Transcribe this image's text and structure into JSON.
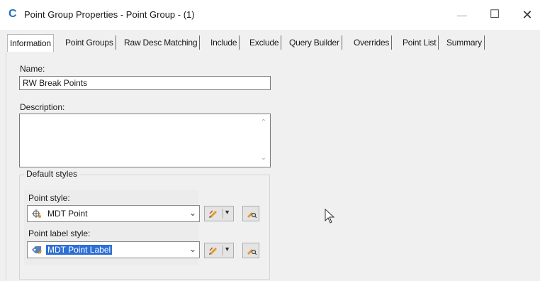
{
  "window": {
    "title": "Point Group Properties - Point Group - (1)",
    "app_icon_glyph": "C",
    "minimize": "—",
    "maximize": "☐",
    "close": "✕"
  },
  "tabs": [
    {
      "label": "Information",
      "active": true
    },
    {
      "label": "Point Groups"
    },
    {
      "label": "Raw Desc Matching"
    },
    {
      "label": "Include"
    },
    {
      "label": "Exclude"
    },
    {
      "label": "Query Builder"
    },
    {
      "label": "Overrides"
    },
    {
      "label": "Point List"
    },
    {
      "label": "Summary"
    }
  ],
  "form": {
    "name_label": "Name:",
    "name_value": "RW Break Points",
    "description_label": "Description:",
    "description_value": "",
    "default_styles_title": "Default styles",
    "point_style_label": "Point style:",
    "point_style_value": "MDT Point",
    "point_label_style_label": "Point label style:",
    "point_label_style_value": "MDT Point Label"
  },
  "icons": {
    "point_style": "point-marker-icon",
    "label_style": "label-tag-icon",
    "edit": "edit-pencil-icon",
    "browse": "style-browse-icon",
    "cursor": "mouse-cursor-icon"
  },
  "colors": {
    "accent": "#1f6fc5",
    "selection": "#2e6fd6"
  }
}
